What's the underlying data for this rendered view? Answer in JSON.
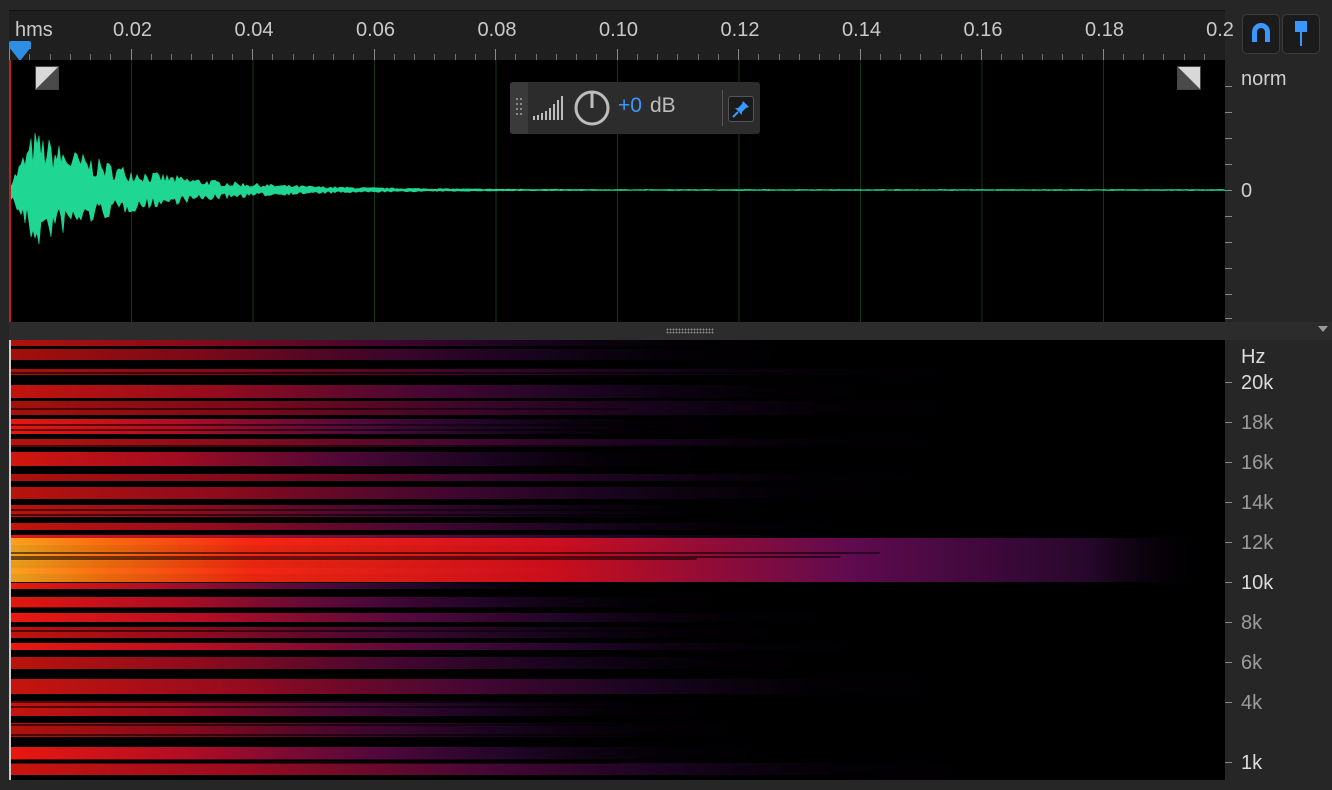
{
  "ruler": {
    "units": "hms",
    "labels": [
      "0.02",
      "0.04",
      "0.06",
      "0.08",
      "0.10",
      "0.12",
      "0.14",
      "0.16",
      "0.18",
      "0.2"
    ]
  },
  "toolbar": {
    "snap_icon": "magnet-icon",
    "marker_icon": "marker-pin-icon"
  },
  "waveform": {
    "scale_top": "norm",
    "scale_zero": "0",
    "color": "#1fd692",
    "fade_in_icon": "fade-in-icon",
    "fade_out_icon": "fade-out-icon"
  },
  "gain_hud": {
    "value": "+0",
    "unit": "dB",
    "meter_icon": "level-meter-icon",
    "knob_icon": "gain-knob-icon",
    "pin_icon": "pin-icon"
  },
  "spectrogram": {
    "unit": "Hz",
    "labels": [
      "20k",
      "18k",
      "16k",
      "14k",
      "12k",
      "10k",
      "8k",
      "6k",
      "4k",
      "1k"
    ]
  },
  "colors": {
    "accent": "#2f8de4",
    "playhead": "#c21d1d"
  }
}
